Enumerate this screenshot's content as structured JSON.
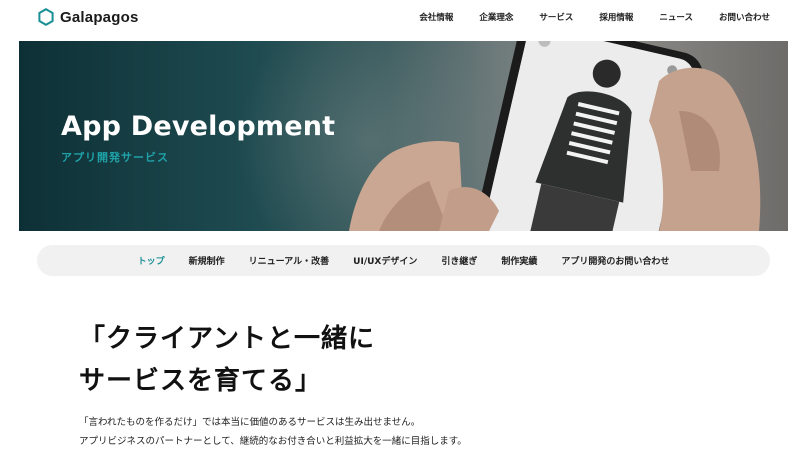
{
  "header": {
    "logo_text": "Galapagos",
    "nav": [
      "会社情報",
      "企業理念",
      "サービス",
      "採用情報",
      "ニュース",
      "お問い合わせ"
    ]
  },
  "hero": {
    "title": "App Development",
    "subtitle": "アプリ開発サービス"
  },
  "subnav": {
    "items": [
      "トップ",
      "新規制作",
      "リニューアル・改善",
      "UI/UXデザイン",
      "引き継ぎ",
      "制作実績",
      "アプリ開発のお問い合わせ"
    ],
    "active": "トップ"
  },
  "main": {
    "headline_line1": "「クライアントと一緒に",
    "headline_line2": "サービスを育てる」",
    "lead_line1": "「言われたものを作るだけ」では本当に価値のあるサービスは生み出せません。",
    "lead_line2": "アプリビジネスのパートナーとして、継続的なお付き合いと利益拡大を一緒に目指します。"
  },
  "colors": {
    "accent": "#1a8f95",
    "hero_subtitle": "#1fa2a8",
    "hero_dark": "#0d3036",
    "subnav_bg": "#f1f1f1"
  }
}
